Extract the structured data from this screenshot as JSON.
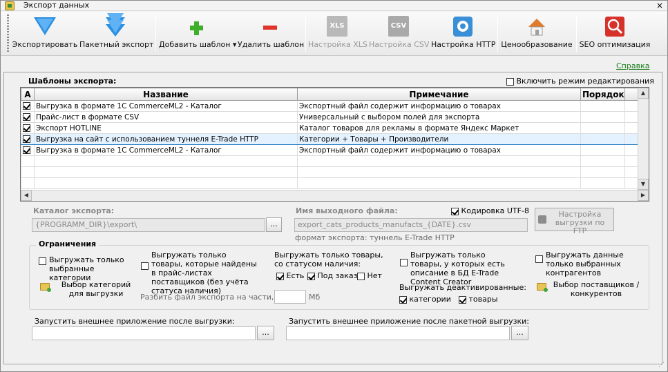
{
  "window": {
    "title": "Экспорт данных",
    "close": "×"
  },
  "toolbar": {
    "export": "Экспортировать",
    "batch_export": "Пакетный экспорт",
    "add_template": "Добавить шаблон",
    "remove_template": "Удалить шаблон",
    "xls_settings": "Настройка XLS",
    "csv_settings": "Настройка CSV",
    "http_settings": "Настройка HTTP",
    "pricing": "Ценообразование",
    "seo": "SEO оптимизация",
    "xls_icon_text": "XLS",
    "csv_icon_text": "CSV",
    "dropdown_arrow": "▾"
  },
  "help": "Справка",
  "templates": {
    "heading": "Шаблоны экспорта:",
    "edit_mode_label": "Включить режим редактирования",
    "edit_mode_checked": false,
    "columns": [
      "A",
      "Название",
      "Примечание",
      "Порядок"
    ],
    "rows": [
      {
        "checked": true,
        "name": "Выгрузка в формате 1С CommerceML2 - Каталог",
        "note": "Экспортный файл содержит информацию о товарах",
        "order": ""
      },
      {
        "checked": true,
        "name": "Прайс-лист в формате CSV",
        "note": "Универсальный с выбором полей для экспорта",
        "order": ""
      },
      {
        "checked": true,
        "name": "Экспорт HOTLINE",
        "note": "Каталог товаров для рекламы в формате Яндекс Маркет",
        "order": ""
      },
      {
        "checked": true,
        "name": "Выгрузка на сайт с использованием туннеля E-Trade HTTP",
        "note": "Категории + Товары + Производители",
        "order": "",
        "selected": true
      },
      {
        "checked": true,
        "name": "Выгрузка в формате 1С CommerceML2 - Каталог",
        "note": "Экспортный файл содержит информацию о товарах",
        "order": ""
      }
    ]
  },
  "catalog": {
    "label": "Каталог экспорта:",
    "value": "{PROGRAMM_DIR}\\export\\",
    "browse": "..."
  },
  "output": {
    "label": "Имя выходного файла:",
    "value": "export_cats_products_manufacts_{DATE}.csv",
    "format_note": "формат экспорта: туннель E-Trade HTTP",
    "utf8_label": "Кодировка UTF-8",
    "utf8_checked": true,
    "ftp_button": "Настройка выгрузки по FTP"
  },
  "limits": {
    "title": "Ограничения",
    "only_selected_categories": "Выгружать только выбранные категории",
    "select_categories": "Выбор категорий для выгрузки",
    "only_found_in_prices": "Выгружать только товары, которые найдены в прайс-листах поставщиков (без учёта статуса наличия)",
    "split_label": "Разбить файл экспорта на части, по:",
    "split_value": "",
    "split_unit": "Мб",
    "status_label": "Выгружать только товары, со статусом наличия:",
    "status_yes": "Есть",
    "status_order": "Под заказ",
    "status_no": "Нет",
    "status_yes_checked": true,
    "status_order_checked": true,
    "status_no_checked": false,
    "with_description": "Выгружать только товары, у которых есть описание в БД E-Trade Content Creator",
    "deactivated_label": "Выгружать деактивированные:",
    "deactivated_categories": "категории",
    "deactivated_products": "товары",
    "deactivated_categories_checked": true,
    "deactivated_products_checked": true,
    "only_selected_contractors": "Выгружать данные только выбранных контрагентов",
    "select_suppliers": "Выбор поставщиков / конкурентов"
  },
  "run_after": {
    "label": "Запустить внешнее приложение после выгрузки:",
    "value": "",
    "browse": "..."
  },
  "run_after_batch": {
    "label": "Запустить внешнее приложение после пакетной выгрузки:",
    "value": "",
    "browse": "..."
  },
  "colors": {
    "accent_blue": "#2d8fe0",
    "link_green": "#1b7e1b",
    "selection": "#e4f2ff"
  }
}
